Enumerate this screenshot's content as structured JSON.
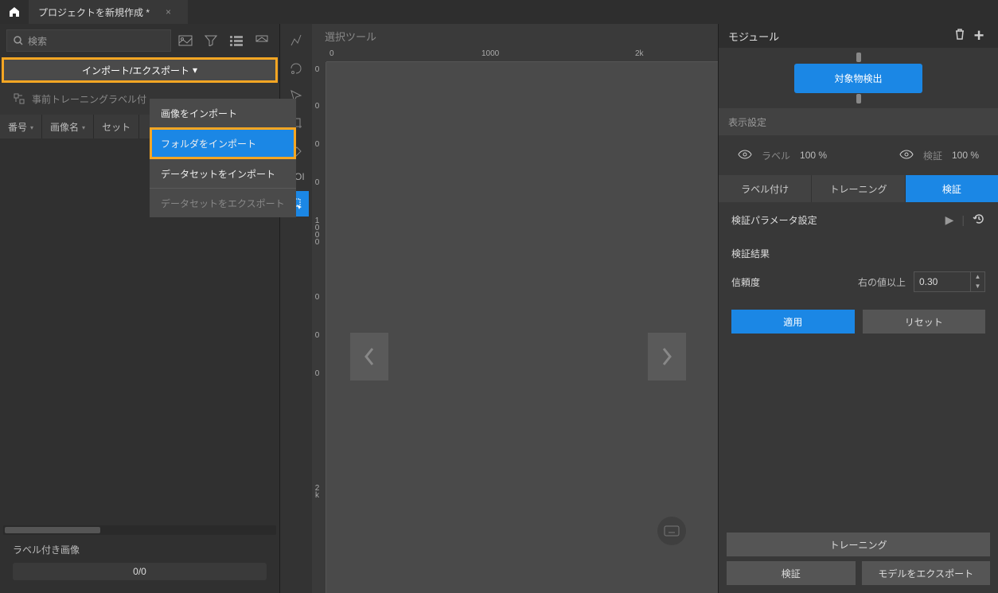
{
  "tab_title": "プロジェクトを新規作成 *",
  "search": {
    "placeholder": "検索"
  },
  "import_export_label": "インポート/エクスポート",
  "dropdown": {
    "import_image": "画像をインポート",
    "import_folder": "フォルダをインポート",
    "import_dataset": "データセットをインポート",
    "export_dataset": "データセットをエクスポート"
  },
  "pretrain_label": "事前トレーニングラベル付",
  "columns": {
    "num": "番号",
    "name": "画像名",
    "set": "セット"
  },
  "labeled_images": "ラベル付き画像",
  "progress_text": "0/0",
  "canvas_title": "選択ツール",
  "ruler_h": [
    "0",
    "1000",
    "2k"
  ],
  "ruler_v": [
    "0",
    "0",
    "0",
    "0",
    "1000",
    "0",
    "0",
    "0",
    "2k"
  ],
  "tool_roi": "ROI",
  "right": {
    "title": "モジュール",
    "node_label": "対象物検出",
    "display_settings": "表示設定",
    "vis_label": "ラベル",
    "vis_verify": "検証",
    "vis_pct1": "100 %",
    "vis_pct2": "100 %",
    "tabs": {
      "labeling": "ラベル付け",
      "training": "トレーニング",
      "verify": "検証"
    },
    "param_header": "検証パラメータ設定",
    "result_label": "検証結果",
    "confidence_label": "信頼度",
    "confidence_cond": "右の値以上",
    "confidence_value": "0.30",
    "apply": "適用",
    "reset": "リセット",
    "footer_training": "トレーニング",
    "footer_verify": "検証",
    "footer_export": "モデルをエクスポート"
  }
}
